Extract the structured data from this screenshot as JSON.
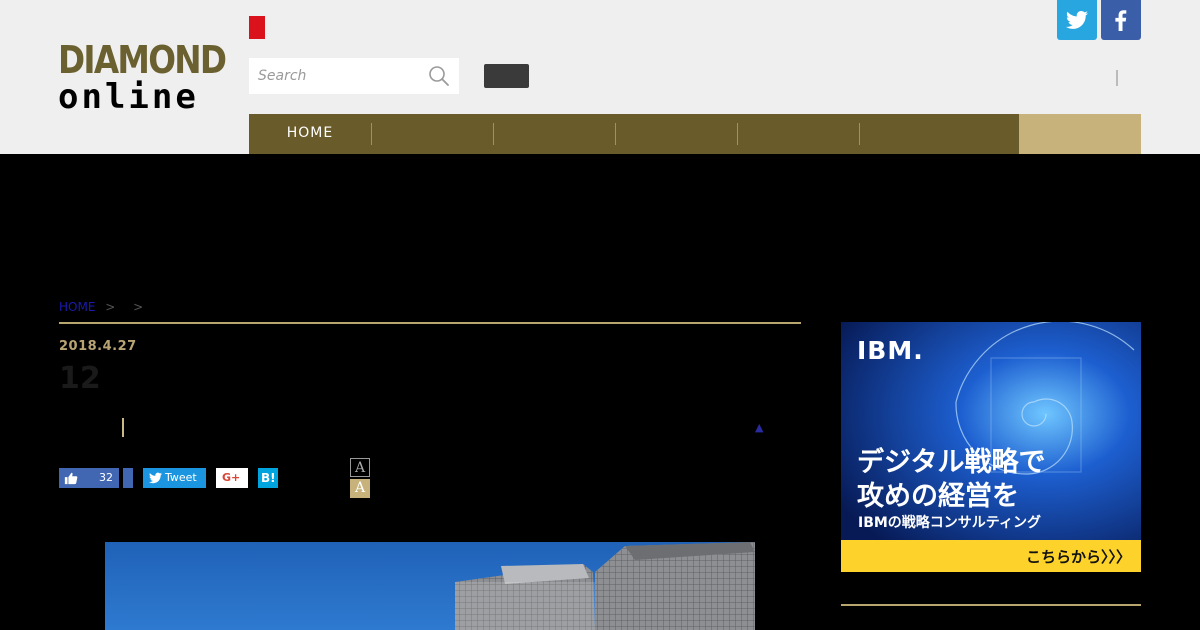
{
  "header": {
    "logo_top": "DIAMOND",
    "logo_bottom": "online",
    "search_placeholder": "Search",
    "social": [
      "twitter-icon",
      "facebook-icon"
    ]
  },
  "nav": {
    "items": [
      "HOME",
      "",
      "",
      "",
      "",
      "",
      ""
    ]
  },
  "breadcrumb": {
    "home": "HOME",
    "sep1": ">",
    "sep2": ">"
  },
  "article": {
    "date": "2018.4.27",
    "title": "12",
    "triangle": "▲",
    "like_count": "32",
    "tweet_label": "Tweet",
    "gplus_label": "G+",
    "hatena_label": "B!",
    "font_small": "A",
    "font_large": "A"
  },
  "ad": {
    "logo": "IBM.",
    "headline_line1": "デジタル戦略で",
    "headline_line2": "攻めの経営を",
    "subline": "IBMの戦略コンサルティング",
    "cta": "こちらから〉〉〉"
  },
  "colors": {
    "brand_gold": "#6a5b2a",
    "nav_active": "#c6b27a",
    "accent_rule": "#b7a66e",
    "twitter": "#27a6e0",
    "facebook": "#3b5ea8"
  }
}
